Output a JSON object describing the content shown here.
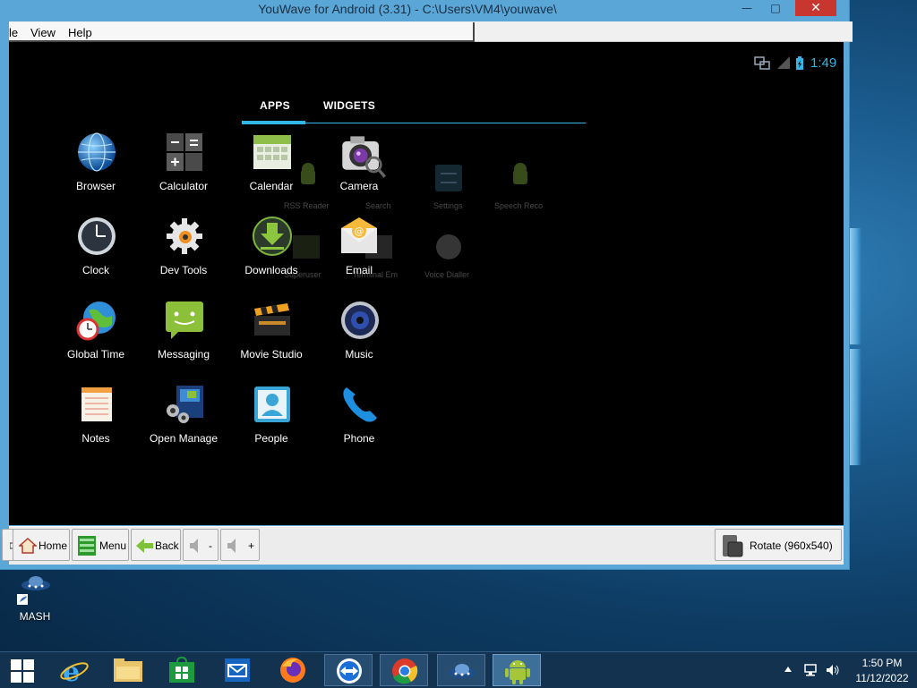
{
  "window": {
    "title": "YouWave for Android (3.31) - C:\\Users\\VM4\\youwave\\",
    "minimize": "—",
    "maximize": "□",
    "close": "✕"
  },
  "menu": {
    "file": "le",
    "view": "View",
    "help": "Help"
  },
  "status": {
    "time": "1:49"
  },
  "tabs": {
    "apps": "APPS",
    "widgets": "WIDGETS"
  },
  "apps": [
    {
      "label": "Browser"
    },
    {
      "label": "Calculator"
    },
    {
      "label": "Calendar"
    },
    {
      "label": "Camera"
    },
    {
      "label": "Clock"
    },
    {
      "label": "Dev Tools"
    },
    {
      "label": "Downloads"
    },
    {
      "label": "Email"
    },
    {
      "label": "Global Time"
    },
    {
      "label": "Messaging"
    },
    {
      "label": "Movie Studio"
    },
    {
      "label": "Music"
    },
    {
      "label": "Notes"
    },
    {
      "label": "Open Manage"
    },
    {
      "label": "People"
    },
    {
      "label": "Phone"
    }
  ],
  "ghost_apps": [
    {
      "label": "RSS Reader"
    },
    {
      "label": "Search"
    },
    {
      "label": "Settings"
    },
    {
      "label": "Speech Reco"
    },
    {
      "label": "Superuser"
    },
    {
      "label": "Terminal Em"
    },
    {
      "label": "Voice Dialler"
    }
  ],
  "toolbar": {
    "home": "Home",
    "menu": "Menu",
    "back": "Back",
    "vol_down": "-",
    "vol_up": "+",
    "rotate": "Rotate (960x540)"
  },
  "desktop": {
    "mash": "MASH"
  },
  "taskbar": {
    "time": "1:50 PM",
    "date": "11/12/2022"
  },
  "colors": {
    "accent": "#33b5e5",
    "titlebar": "#5aa6d6",
    "close": "#c7372f"
  }
}
